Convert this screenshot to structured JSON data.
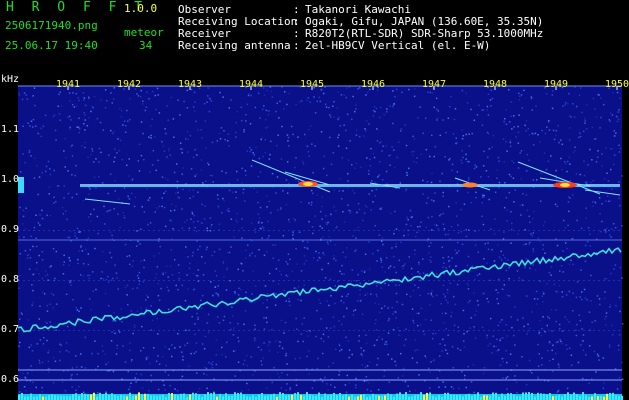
{
  "header": {
    "app_title": "H R O F F T",
    "version": "1.0.0",
    "filename": "2506171940.png",
    "timestamp": "25.06.17 19:40",
    "meteor_label": "meteor",
    "meteor_count": "34",
    "info": [
      {
        "key": "Observer",
        "value": "Takanori Kawachi"
      },
      {
        "key": "Receiving Location",
        "value": "Ogaki, Gifu, JAPAN (136.60E, 35.35N)"
      },
      {
        "key": "Receiver",
        "value": "R820T2(RTL-SDR) SDR-Sharp 53.1000MHz"
      },
      {
        "key": "Receiving antenna",
        "value": "2el-HB9CV Vertical (el. E-W)"
      }
    ]
  },
  "plot": {
    "y_unit": "kHz",
    "y_ticks": [
      "1.1",
      "1.0",
      "0.9",
      "0.8",
      "0.7",
      "0.6"
    ],
    "x_ticks": [
      "1941",
      "1942",
      "1943",
      "1944",
      "1945",
      "1946",
      "1947",
      "1948",
      "1949",
      "1950"
    ],
    "y_range_khz": [
      0.58,
      1.18
    ],
    "carrier_khz": 0.99,
    "drift_start_khz": 0.7,
    "drift_end_khz": 0.86,
    "colors": {
      "background": "#0a0f8a",
      "tick_text": "#ffffff",
      "time_text": "#ffff3a"
    }
  }
}
